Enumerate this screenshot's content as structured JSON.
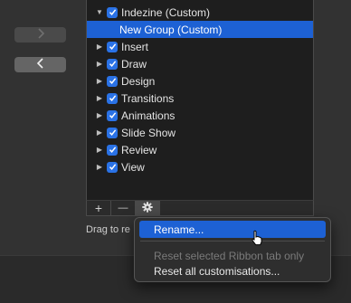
{
  "ribbon_list": {
    "items": [
      {
        "label": "Indezine (Custom)",
        "expanded": true,
        "checked": true,
        "level": 0
      },
      {
        "label": "New Group (Custom)",
        "selected": true,
        "level": 1
      },
      {
        "label": "Insert",
        "expanded": false,
        "checked": true,
        "level": 0
      },
      {
        "label": "Draw",
        "expanded": false,
        "checked": true,
        "level": 0
      },
      {
        "label": "Design",
        "expanded": false,
        "checked": true,
        "level": 0
      },
      {
        "label": "Transitions",
        "expanded": false,
        "checked": true,
        "level": 0
      },
      {
        "label": "Animations",
        "expanded": false,
        "checked": true,
        "level": 0
      },
      {
        "label": "Slide Show",
        "expanded": false,
        "checked": true,
        "level": 0
      },
      {
        "label": "Review",
        "expanded": false,
        "checked": true,
        "level": 0
      },
      {
        "label": "View",
        "expanded": false,
        "checked": true,
        "level": 0
      }
    ]
  },
  "toolbar": {
    "add_label": "+",
    "remove_label": "—"
  },
  "hint_text": "Drag to re",
  "context_menu": {
    "items": [
      {
        "label": "Rename...",
        "highlighted": true,
        "enabled": true
      },
      {
        "label": "Reset selected Ribbon tab only",
        "enabled": false
      },
      {
        "label": "Reset all customisations...",
        "enabled": true
      }
    ]
  },
  "colors": {
    "accent": "#1d61d4",
    "checkbox": "#2a72e6",
    "background": "#323232"
  }
}
